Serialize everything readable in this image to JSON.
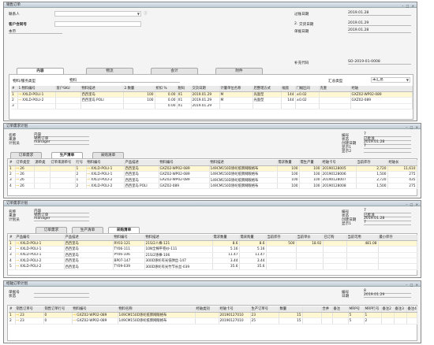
{
  "w1": {
    "title": "销售订单",
    "customer_label": "联系人",
    "customer_ref_label": "客户合同号",
    "currency": "本币",
    "post_date_label": "过账日期",
    "post_date": "2019.01.28",
    "due_date_label": "交货日期",
    "due_date_prefix": "2.",
    "due_date": "2019.01.29",
    "doc_date_label": "单据日期",
    "doc_date": "2019.01.28",
    "tabs": [
      "内容",
      "物流",
      "会计",
      "附件"
    ],
    "item_type_label": "物料/服务类型",
    "item_type": "物料",
    "summary_label": "汇总类型",
    "summary": "未汇总",
    "plan_code_label": "补充代码",
    "plan_code": "SO-2019-01-0008",
    "headers": [
      "#",
      "1.物料编号",
      "客户SKU",
      "物料描述",
      "2.数量",
      "折扣 %",
      "税码",
      "交货日期",
      "计量单位名称",
      "后整理方式",
      "幅宽",
      "门幅区间",
      "克重",
      "经轴"
    ],
    "rows": [
      [
        "1",
        "XXLD-POLI-1",
        "",
        "西西里岛",
        "100",
        "0.00",
        "X1",
        "2019.01.29",
        "M",
        "光面型",
        "144",
        "±0.02",
        "",
        "GXZ02-WP02-089"
      ],
      [
        "2",
        "XXLD-POLI-2",
        "",
        "西西里岛 POLI",
        "100",
        "0.00",
        "X1",
        "2019.01.29",
        "M",
        "光面型",
        "144",
        "±0.02",
        "",
        "GXZ02-089"
      ],
      [
        "3",
        "",
        "",
        "",
        "",
        "0.00",
        "X1",
        "2019.01.29",
        "",
        "",
        "",
        "",
        "",
        ""
      ]
    ]
  },
  "w2": {
    "title": "订单需求计划",
    "labels": [
      "名称",
      "来源",
      "计划员"
    ],
    "values": [
      "内容",
      "销售订单",
      "manager"
    ],
    "rlabels": [
      "编号",
      "状态",
      "创建日期",
      "显示1",
      "显示2"
    ],
    "rvalues": [
      "7",
      "已批准",
      "2019.01.28",
      "7",
      ""
    ],
    "tabs": [
      "订单需求",
      "生产清单",
      "采购清单"
    ],
    "headers": [
      "#",
      "订单类型",
      "源单类",
      "订单来源单号",
      "行号",
      "物料编号",
      "产品描述",
      "物料编号",
      "物料描述",
      "需求数量",
      "需生产量",
      "经轴卡号",
      "当前库存",
      "经轴长"
    ],
    "rows": [
      [
        "1",
        "26",
        "",
        "",
        "1",
        "XXLD-POLI-1",
        "西西里岛",
        "GXZ02-WP02-089",
        "149CM150D涤纶纸牌网眼格布",
        "100",
        "100",
        "20190128005",
        "2,720",
        "11,610"
      ],
      [
        "2",
        "26",
        "",
        "",
        "2",
        "XXLD-POLI-1",
        "西西里岛",
        "GXZ02-WP02-089",
        "149CM150D涤纶纸牌网眼格布",
        "100",
        "100",
        "20190128006",
        "1,500",
        "275"
      ],
      [
        "3",
        "26",
        "",
        "",
        "1",
        "XXLD-POLI-2",
        "西西里岛",
        "GXZ02-WP02-089",
        "149CM150D涤纶纸牌网眼格布",
        "100",
        "100",
        "20190128007",
        "2,720",
        "435"
      ],
      [
        "4",
        "26",
        "",
        "",
        "2",
        "XXLD-POLI-2",
        "西西里岛 POLI",
        "GXZ02-089",
        "149CM150D涤纶纸牌网眼格布",
        "100",
        "100",
        "20190128008",
        "1,500",
        "275"
      ]
    ]
  },
  "w3": {
    "title": "订单需求计划",
    "labels": [
      "名称",
      "来源",
      "计划员"
    ],
    "values": [
      "内容",
      "销售订单",
      "manager"
    ],
    "rlabels": [
      "编号",
      "状态",
      "创建日期",
      "显示1"
    ],
    "rvalues": [
      "7",
      "已批准",
      "2019.01.28",
      "7"
    ],
    "tabs": [
      "订单需求",
      "生产清单",
      "采购清单"
    ],
    "headers": [
      "#",
      "产品编号",
      "产品描述",
      "物料编号",
      "物料描述",
      "需求数量",
      "需采购量",
      "当前库存",
      "当前单价",
      "已订购",
      "当前可用",
      "最小库存"
    ],
    "rows": [
      [
        "1",
        "XXLD-POLI-1",
        "西西里岛",
        "RY03-121",
        "21S/2人棉-121",
        "8.6",
        "8.6",
        "500",
        "18.92",
        "",
        "481.08",
        ""
      ],
      [
        "2",
        "XXLD-POLI-1",
        "西西里岛",
        "TY06-111",
        "10N全棉平卷纱-111",
        "5.16",
        "5.16",
        "",
        "",
        "",
        "",
        ""
      ],
      [
        "3",
        "XXLD-POLI-1",
        "西西里岛",
        "PY06-106",
        "21S/2涤棉-106",
        "11.47",
        "11.47",
        "",
        "",
        "",
        "",
        ""
      ],
      [
        "4",
        "XXLD-POLI-2",
        "西西里岛",
        "BP07-147",
        "300D涤纶有光低弹丝-147",
        "3.44",
        "3.44",
        "",
        "",
        "",
        "",
        ""
      ],
      [
        "5",
        "XXLD-POLI-2",
        "西西里岛",
        "TY09-039",
        "300D涤纶有光竹节长丝-039",
        "35.6",
        "35.6",
        "",
        "",
        "",
        "",
        ""
      ]
    ]
  },
  "w4": {
    "title": "经轴订单计划",
    "labels": [
      "单据号",
      "状态"
    ],
    "values": [
      "",
      ""
    ],
    "rlabels": [
      "编号",
      "日期"
    ],
    "rvalues": [
      "8",
      "2019.01.29"
    ],
    "headers": [
      "#",
      "销售订单号",
      "销售订单行号",
      "物料编号",
      "物料名称",
      "经轴类别",
      "经轴卡号",
      "生产订单号",
      "数量",
      "",
      "合并",
      "备注",
      "MRP号",
      "MRP行号",
      "备注2",
      "备注3",
      "备注4"
    ],
    "rows": [
      [
        "1",
        "23",
        "0",
        "GXZ02-WP02-089",
        "149CM150D涤纶纸牌网眼格布",
        "",
        "20190127010",
        "23",
        "15",
        "",
        "",
        "",
        "5",
        "1",
        "",
        "",
        ""
      ],
      [
        "2",
        "23",
        "0",
        "GXZ02-WP02-089",
        "149CM150D涤纶纸牌网眼格布",
        "",
        "20190127010",
        "25",
        "15",
        "",
        "",
        "",
        "5",
        "2",
        "",
        "",
        ""
      ]
    ]
  }
}
